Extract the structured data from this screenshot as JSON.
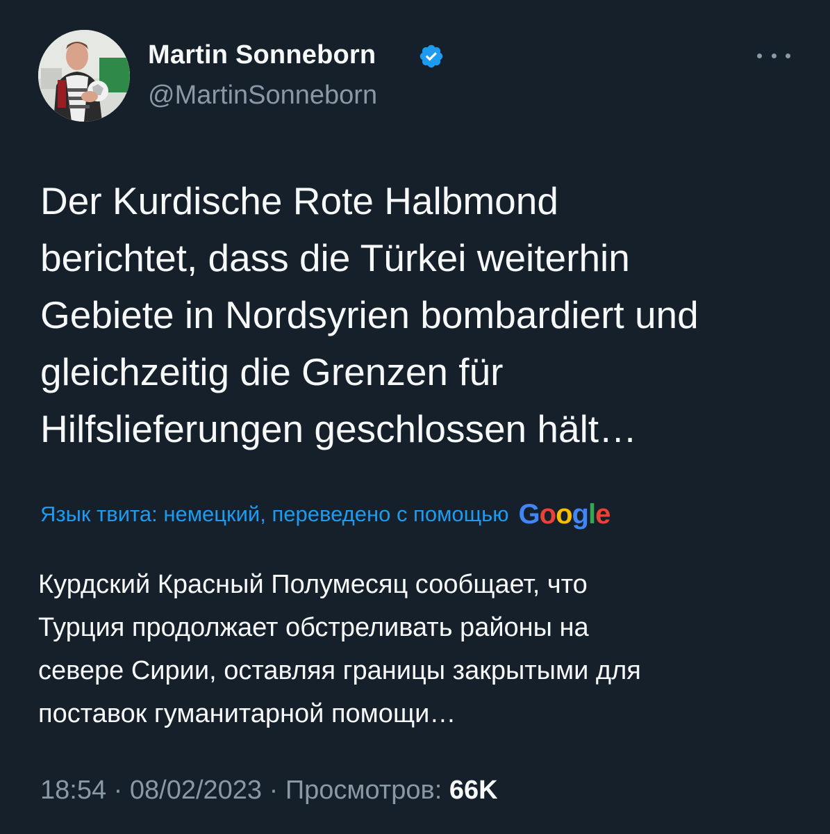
{
  "author": {
    "display_name": "Martin Sonneborn",
    "handle": "@MartinSonneborn",
    "verified": true,
    "avatar_icon": "profile-photo"
  },
  "more_icon": "more-horizontal-icon",
  "tweet": {
    "lines": [
      "Der Kurdische Rote Halbmond",
      "berichtet, dass die Türkei weiterhin",
      "Gebiete in Nordsyrien bombardiert und",
      "gleichzeitig die Grenzen für",
      "Hilfslieferungen geschlossen hält…"
    ]
  },
  "translation": {
    "note": "Язык твита: немецкий, переведено с помощью",
    "provider": "Google",
    "lines": [
      "Курдский Красный Полумесяц сообщает, что",
      "Турция продолжает обстреливать районы на",
      "севере Сирии, оставляя границы закрытыми для",
      "поставок гуманитарной помощи…"
    ]
  },
  "meta": {
    "time": "18:54",
    "separator": " · ",
    "date": "08/02/2023",
    "views_label": "Просмотров:",
    "views_count": "66K"
  },
  "colors": {
    "background": "#15202b",
    "text_primary": "#f7f9f9",
    "text_secondary": "#8b98a5",
    "accent": "#1d9bf0"
  }
}
